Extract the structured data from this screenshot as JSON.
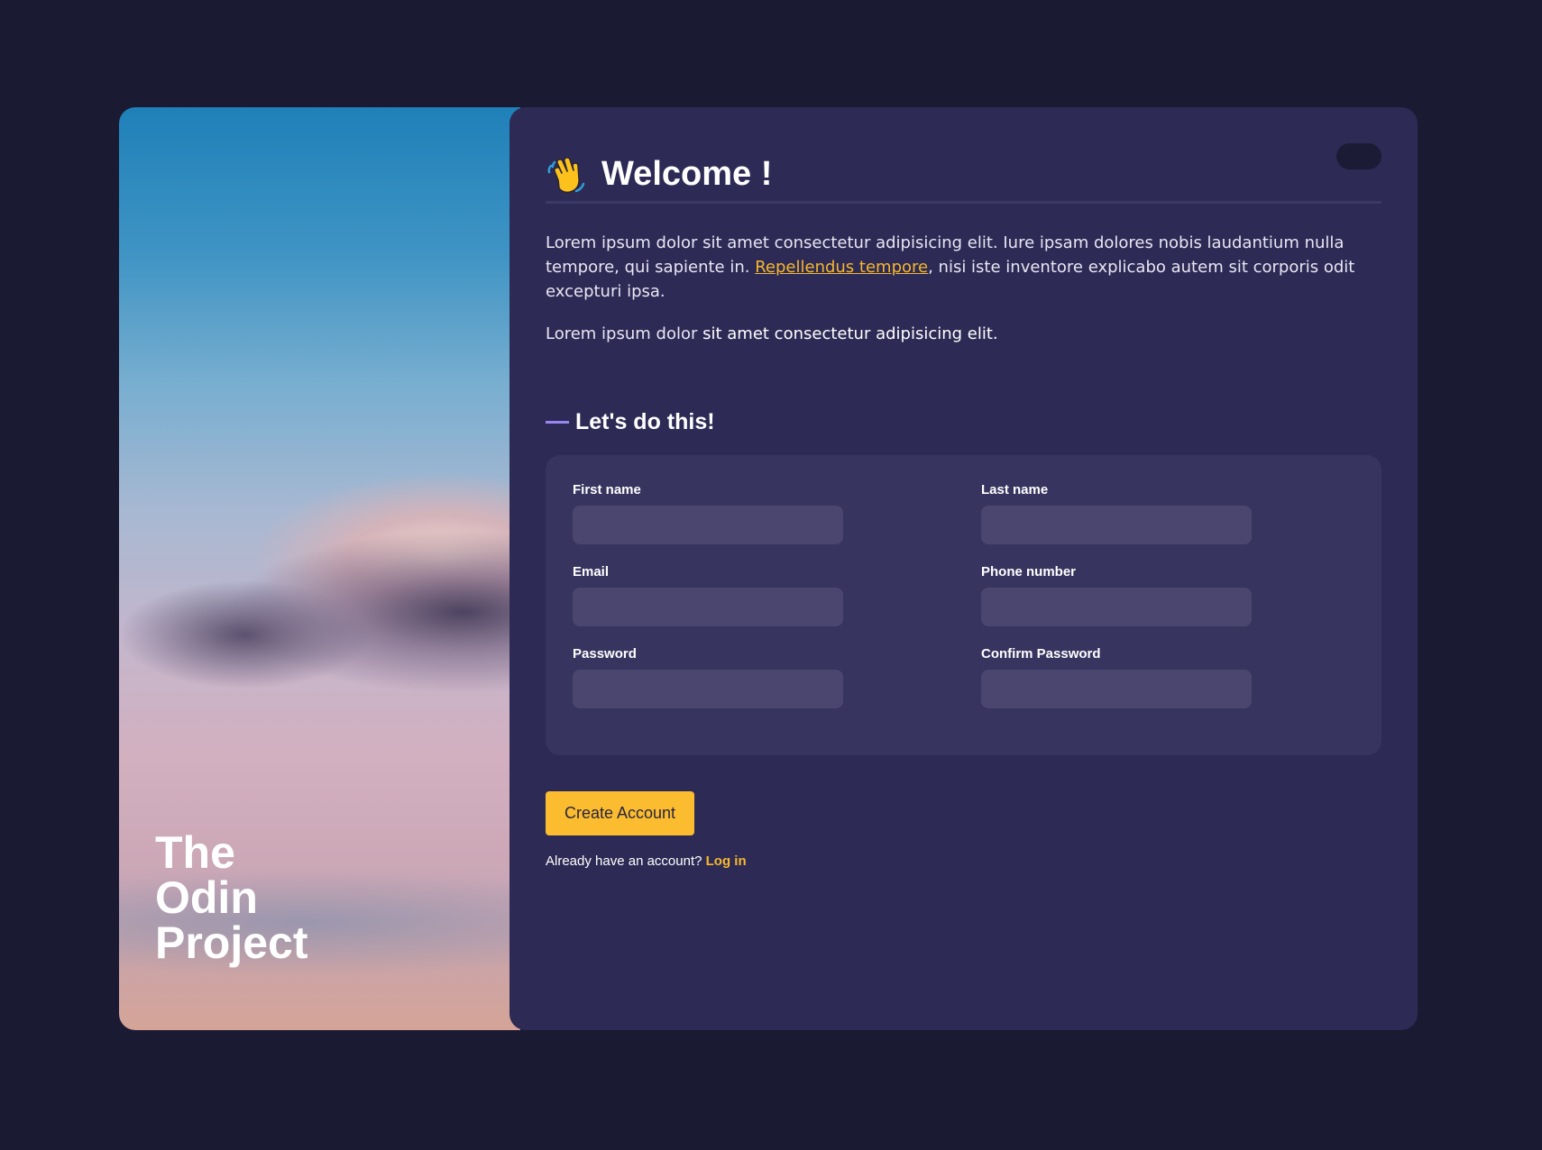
{
  "brand": {
    "hero_title_lines": [
      "The",
      "Odin",
      "Project"
    ]
  },
  "header": {
    "title": "Welcome !",
    "wave_icon": "waving-hand-icon",
    "theme_toggle_icon": "moon-icon"
  },
  "intro": {
    "para1_before": "Lorem ipsum dolor sit amet consectetur adipisicing elit. Iure ipsam dolores nobis laudantium nulla tempore, qui sapiente in. ",
    "para1_link": "Repellendus tempore",
    "para1_after": ", nisi iste inventore explicabo autem sit corporis odit excepturi ipsa.",
    "para2_plain": "Lorem ipsum dolor ",
    "para2_strong": "sit amet consectetur adipisicing elit."
  },
  "form": {
    "section_title": "Let's do this!",
    "fields": [
      {
        "label": "First name",
        "value": ""
      },
      {
        "label": "Last name",
        "value": ""
      },
      {
        "label": "Email",
        "value": ""
      },
      {
        "label": "Phone number",
        "value": ""
      },
      {
        "label": "Password",
        "value": ""
      },
      {
        "label": "Confirm Password",
        "value": ""
      }
    ],
    "submit_label": "Create Account",
    "login_prompt": "Already have an account? ",
    "login_link": "Log in"
  },
  "colors": {
    "background": "#1b1a33",
    "panel": "#2d2b55",
    "form_box": "#37345f",
    "input": "#4a4670",
    "accent": "#fbbd2f",
    "link": "#f6b72e",
    "section_dash": "#9a86f0"
  }
}
